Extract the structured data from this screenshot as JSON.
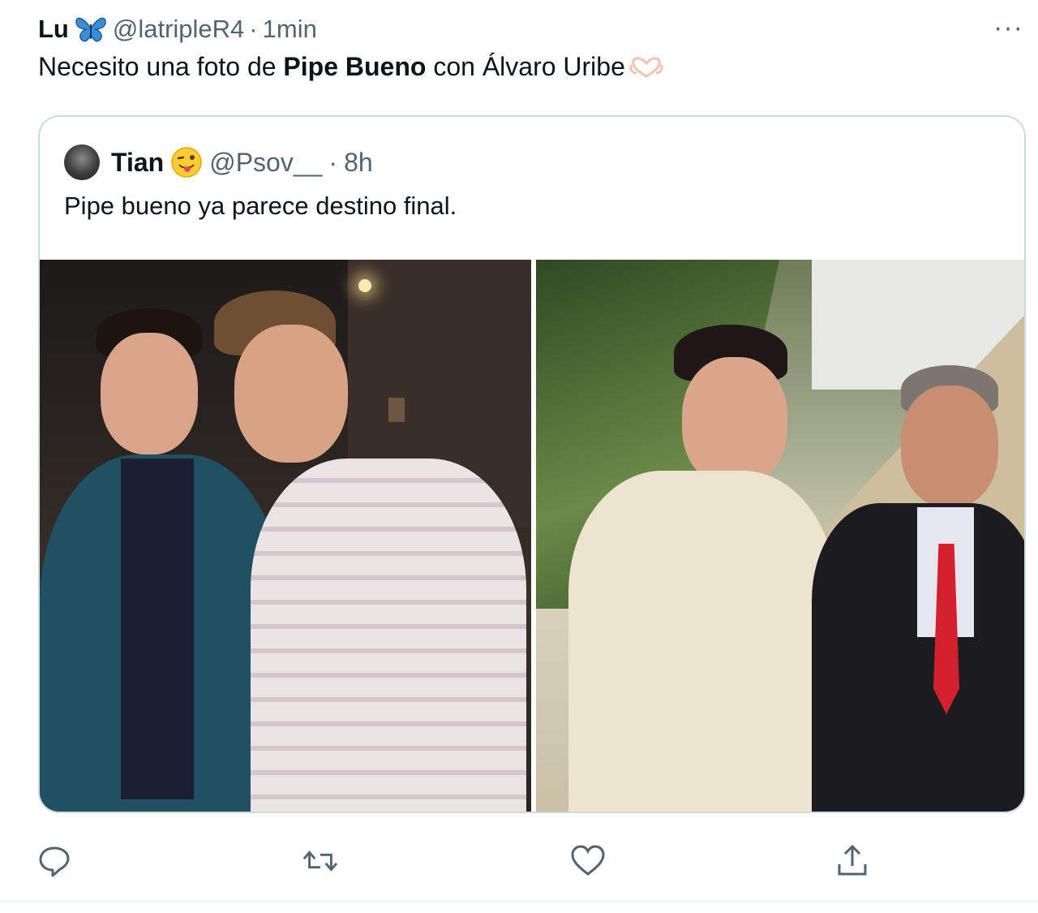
{
  "tweet": {
    "author_name": "Lu",
    "author_emoji_icon": "butterfly-icon",
    "handle": "@latripleR4",
    "separator": "·",
    "time": "1min",
    "more_label": "···",
    "text_part1": "Necesito una foto de ",
    "text_bold": "Pipe Bueno",
    "text_part2": " con Álvaro Uribe",
    "text_emoji_icon": "heart-hands-icon"
  },
  "quoted": {
    "author_name": "Tian",
    "author_emoji_icon": "winking-face-tongue-icon",
    "handle": "@Psov__",
    "separator": "·",
    "time": "8h",
    "text": "Pipe bueno ya parece destino final."
  },
  "actions": [
    {
      "name": "reply",
      "icon": "reply-icon"
    },
    {
      "name": "retweet",
      "icon": "retweet-icon"
    },
    {
      "name": "like",
      "icon": "like-icon"
    },
    {
      "name": "share",
      "icon": "share-icon"
    }
  ],
  "colors": {
    "text": "#0f1419",
    "secondary": "#536471",
    "border": "#cfd9de",
    "butterfly": "#1d9bf0"
  }
}
